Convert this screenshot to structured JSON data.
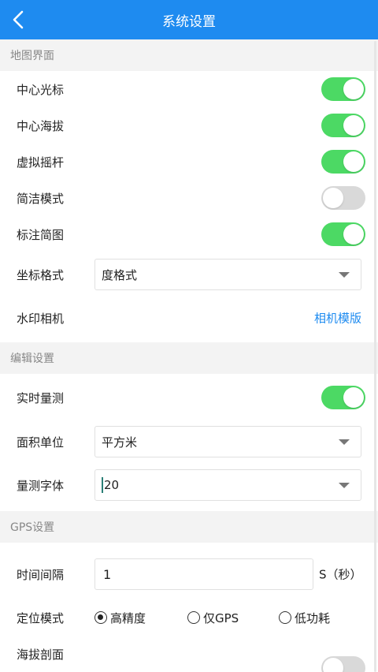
{
  "header": {
    "title": "系统设置"
  },
  "sections": {
    "map": {
      "title": "地图界面",
      "center_cursor": {
        "label": "中心光标",
        "on": true
      },
      "center_altitude": {
        "label": "中心海拔",
        "on": true
      },
      "virtual_joystick": {
        "label": "虚拟摇杆",
        "on": true
      },
      "simple_mode": {
        "label": "简洁模式",
        "on": false
      },
      "annotate_sketch": {
        "label": "标注简图",
        "on": true
      },
      "coord_format": {
        "label": "坐标格式",
        "value": "度格式"
      },
      "watermark_camera": {
        "label": "水印相机",
        "link": "相机模版"
      }
    },
    "edit": {
      "title": "编辑设置",
      "realtime_measure": {
        "label": "实时量测",
        "on": true
      },
      "area_unit": {
        "label": "面积单位",
        "value": "平方米"
      },
      "measure_font": {
        "label": "量测字体",
        "value": "20"
      }
    },
    "gps": {
      "title": "GPS设置",
      "time_interval": {
        "label": "时间间隔",
        "value": "1",
        "unit": "S（秒）"
      },
      "locate_mode": {
        "label": "定位模式",
        "options": [
          "高精度",
          "仅GPS",
          "低功耗"
        ],
        "selected": "高精度"
      },
      "altitude_profile": {
        "label": "海拔剖面",
        "on": false
      }
    }
  },
  "colors": {
    "primary": "#1e8bf0",
    "toggle_on": "#4cd964",
    "toggle_off": "#d9d9d9"
  },
  "icons": {
    "back": "chevron-left-icon"
  }
}
